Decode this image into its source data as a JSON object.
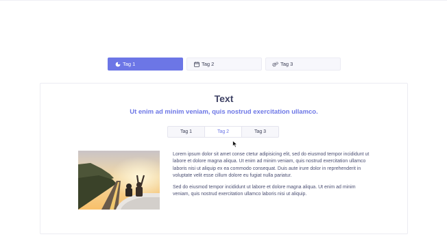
{
  "outer_tabs": [
    {
      "label": "Tag 1",
      "icon": "pie-chart-icon",
      "active": true
    },
    {
      "label": "Tag 2",
      "icon": "calendar-icon",
      "active": false
    },
    {
      "label": "Tag 3",
      "icon": "gears-icon",
      "active": false
    }
  ],
  "card": {
    "title": "Text",
    "subtitle": "Ut enim ad minim veniam, quis nostrud exercitation ullamco.",
    "inner_tabs": [
      {
        "label": "Tag 1",
        "active": false
      },
      {
        "label": "Tag 2",
        "active": true
      },
      {
        "label": "Tag 3",
        "active": false
      }
    ],
    "paragraphs": [
      "Lorem ipsum dolor sit amet conse ctetur adipisicing elit, sed do eiusmod tempor incididunt ut labore et dolore magna aliqua. Ut enim ad minim veniam, quis nostrud exercitation ullamco laboris nisi ut aliquip ex ea commodo consequat. Duis aute irure dolor in reprehenderit in voluptate velit esse cillum dolore eu fugiat nulla pariatur.",
      "Sed do eiusmod tempor incididunt ut labore et dolore magna aliqua. Ut enim ad minim veniam, quis nostrud exercitation ullamco laboris nisi ut aliquip."
    ]
  },
  "colors": {
    "accent": "#6c76e6",
    "heading": "#3d4063",
    "body_text": "#4a4e72"
  }
}
